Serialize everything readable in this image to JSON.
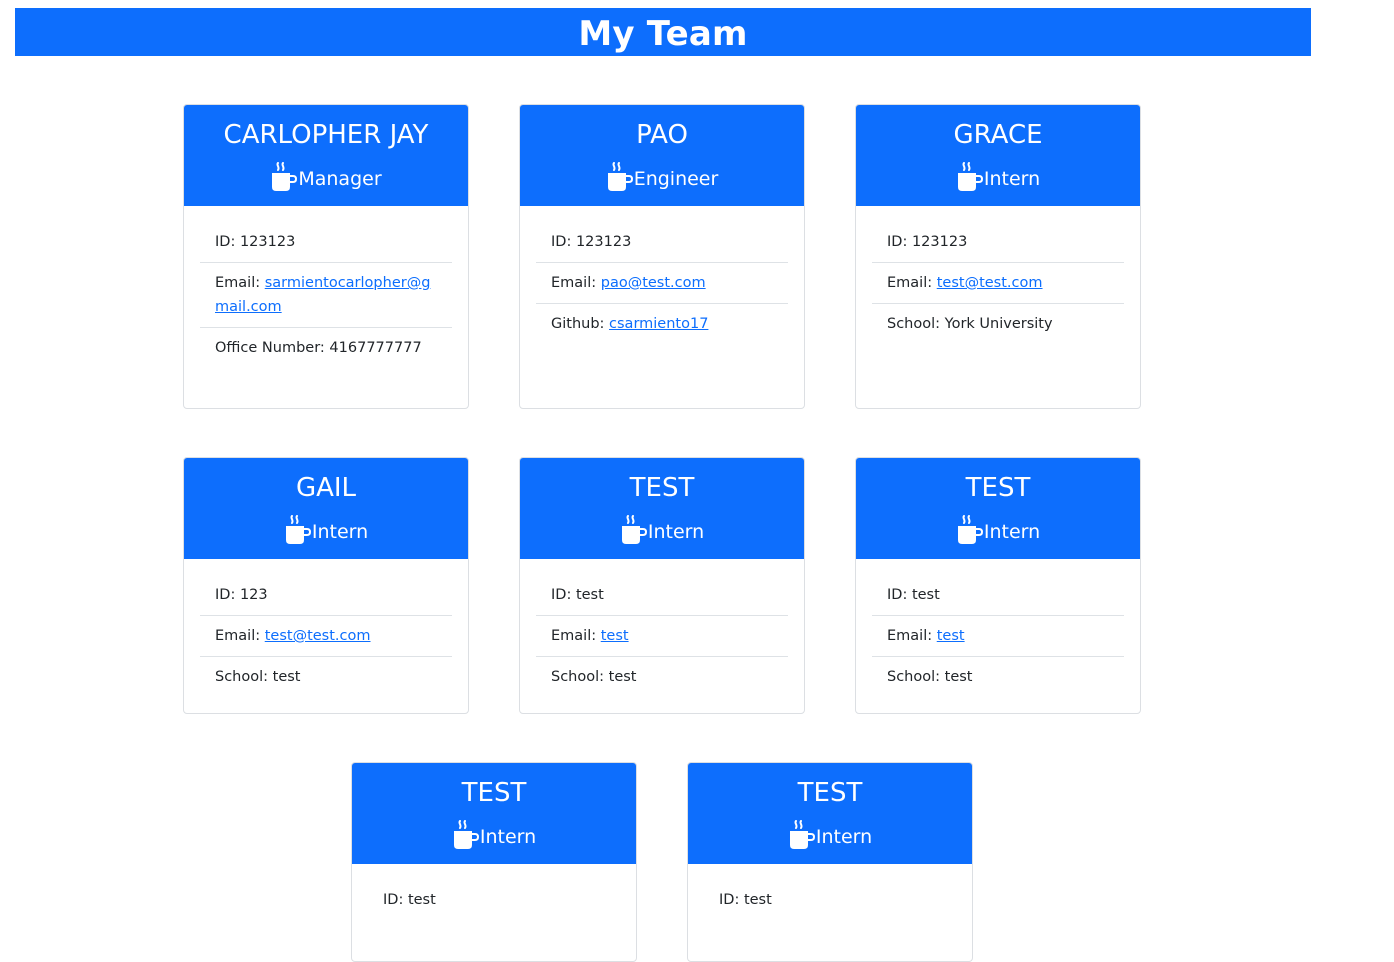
{
  "header": {
    "title": "My Team"
  },
  "labels": {
    "id": "ID: ",
    "email": "Email: ",
    "office": "Office Number: ",
    "github": "Github: ",
    "school": "School: "
  },
  "cards": [
    {
      "name": "CARLOPHER JAY",
      "role": "Manager",
      "icon": "mug-hot-icon",
      "id": "123123",
      "email": "sarmientocarlopher@gmail.com",
      "office": "4167777777"
    },
    {
      "name": "PAO",
      "role": "Engineer",
      "icon": "mug-hot-icon",
      "id": "123123",
      "email": "pao@test.com",
      "github": "csarmiento17"
    },
    {
      "name": "GRACE",
      "role": "Intern",
      "icon": "mug-hot-icon",
      "id": "123123",
      "email": "test@test.com",
      "school": "York University"
    },
    {
      "name": "GAIL",
      "role": "Intern",
      "icon": "mug-hot-icon",
      "id": "123",
      "email": "test@test.com",
      "school": "test"
    },
    {
      "name": "TEST",
      "role": "Intern",
      "icon": "mug-hot-icon",
      "id": "test",
      "email": "test",
      "school": "test"
    },
    {
      "name": "TEST",
      "role": "Intern",
      "icon": "mug-hot-icon",
      "id": "test",
      "email": "test",
      "school": "test"
    },
    {
      "name": "TEST",
      "role": "Intern",
      "icon": "mug-hot-icon",
      "id": "test"
    },
    {
      "name": "TEST",
      "role": "Intern",
      "icon": "mug-hot-icon",
      "id": "test"
    }
  ],
  "colors": {
    "primary": "#0d6efd",
    "text": "#212529",
    "divider": "#dee2e6"
  }
}
